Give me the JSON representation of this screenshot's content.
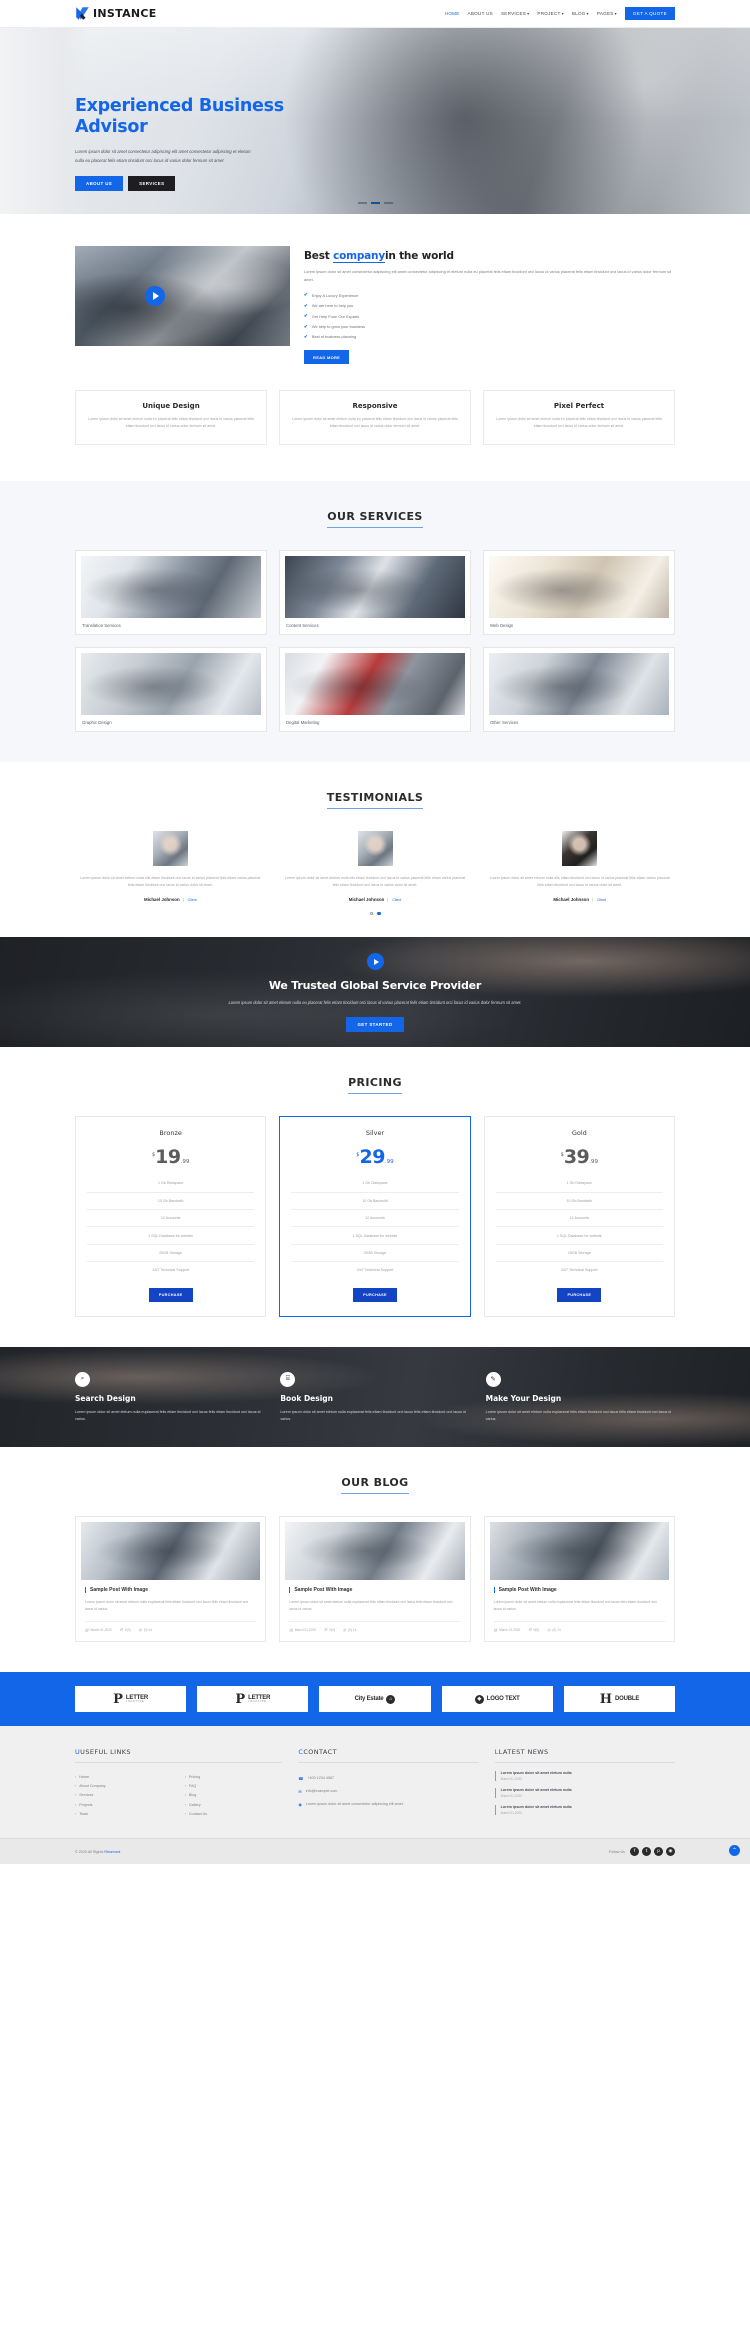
{
  "header": {
    "brand": "INSTANCE",
    "logo_icon": "x-logo-icon",
    "nav": [
      {
        "label": "HOME",
        "active": true,
        "caret": false
      },
      {
        "label": "ABOUT US",
        "active": false,
        "caret": false
      },
      {
        "label": "SERVICES",
        "active": false,
        "caret": true
      },
      {
        "label": "PROJECT",
        "active": false,
        "caret": true
      },
      {
        "label": "BLOG",
        "active": false,
        "caret": true
      },
      {
        "label": "PAGES",
        "active": false,
        "caret": true
      }
    ],
    "cta": "GET A QUOTE",
    "accent": "#1366e8"
  },
  "hero": {
    "title": "Experienced Business Advisor",
    "paragraph": "Lorem ipsum dolor sit amet consectetur adipiscing elit amet consectetur adipiscing et eletum nulla eu placerat felis etiam tincidunt orci lacus id varius dolor fermum sit amet",
    "btn_primary": "ABOUT US",
    "btn_secondary": "SERVICES",
    "dots": [
      false,
      true,
      false
    ]
  },
  "about": {
    "heading_pre": "Best ",
    "heading_hl": "company",
    "heading_post": "in the world",
    "paragraph": "Lorem ipsum dolor sit amet consectetur adipiscing elit amet consectetur adipiscing et eletum nulla eu placerat felis etiam tincidunt orci lacus id varius placerat felis etiam tincidunt orci lacus id varius dolor fermum sit amet.",
    "checks": [
      "Enjoy A Luxury Experience",
      "We are here to help you",
      "Get Help From Our Exparts",
      "We help to grow your business",
      "Best of business planning"
    ],
    "button": "READ MORE",
    "play_icon": "play-icon"
  },
  "features": [
    {
      "title": "Unique Design",
      "text": "Lorem ipsum dolor sit amet eletum nulla eu placerat felis etiam tincidunt orci lacus id varius placerat felis etiam tincidunt orci lacus id varius dolor fermum sit amet."
    },
    {
      "title": "Responsive",
      "text": "Lorem ipsum dolor sit amet eletum nulla eu placerat felis etiam tincidunt orci lacus id varius placerat felis etiam tincidunt orci lacus id varius dolor fermum sit amet."
    },
    {
      "title": "Pixel Perfect",
      "text": "Lorem ipsum dolor sit amet eletum nulla eu placerat felis etiam tincidunt orci lacus id varius placerat felis etiam tincidunt orci lacus id varius dolor fermum sit amet."
    }
  ],
  "services": {
    "title": "OUR SERVICES",
    "items": [
      {
        "caption": "Translation Services"
      },
      {
        "caption": "Content Services"
      },
      {
        "caption": "Web Design"
      },
      {
        "caption": "Graphic Design"
      },
      {
        "caption": "Degital Marketing"
      },
      {
        "caption": "Other Services"
      }
    ]
  },
  "testimonials": {
    "title": "TESTIMONIALS",
    "items": [
      {
        "quote": "Lorem ipsum dolor sit amet eletum nulla elis etiam tincidunt orci lacus id varius placerat felis etiam varius placerat felis etiam tincidunt orci lacus id varius dolor sit amet.",
        "name": "Michael Johnson",
        "role": "Client"
      },
      {
        "quote": "Lorem ipsum dolor sit amet eletum nulla elis etiam tincidunt orci lacus id varius placerat felis etiam varius placerat felis etiam tincidunt orci lacus id varius dolor sit amet.",
        "name": "Michael Johnson",
        "role": "Client"
      },
      {
        "quote": "Lorem ipsum dolor sit amet eletum nulla elis etiam tincidunt orci lacus id varius placerat felis etiam varius placerat felis etiam tincidunt orci lacus id varius dolor sit amet.",
        "name": "Michael Johnson",
        "role": "Client"
      }
    ],
    "dots": [
      false,
      true
    ]
  },
  "cta": {
    "title": "We Trusted Global Service Provider",
    "paragraph": "Lorem ipsum dolor sit amet eletum nulla eu placerat felis etiam tincidunt orci lacus id varius placerat felis etiam tincidunt orci lacus id varius dolor fermum sit amet.",
    "button": "GET STARTED",
    "play_icon": "play-icon"
  },
  "pricing": {
    "title": "PRICING",
    "plans": [
      {
        "name": "Bronze",
        "currency": "$",
        "price": "19",
        "cents": ".99",
        "featured": false,
        "features": [
          "1 Gb Diskspace",
          "10 Gb Bandwith",
          "12 Accounts",
          "1 SQL Database for website",
          "25GB Storage",
          "24/7 Technical Support"
        ],
        "button": "PURCHASE"
      },
      {
        "name": "Silver",
        "currency": "$",
        "price": "29",
        "cents": ".99",
        "featured": true,
        "features": [
          "1 Gb Diskspace",
          "10 Gb Bandwith",
          "12 Accounts",
          "1 SQL Database for website",
          "25GB Storage",
          "24/7 Technical Support"
        ],
        "button": "PURCHASE"
      },
      {
        "name": "Gold",
        "currency": "$",
        "price": "39",
        "cents": ".99",
        "featured": false,
        "features": [
          "1 Gb Diskspace",
          "10 Gb Bandwith",
          "12 Accounts",
          "1 SQL Database for website",
          "25GB Storage",
          "24/7 Technical Support"
        ],
        "button": "PURCHASE"
      }
    ]
  },
  "process": [
    {
      "icon": "search-icon",
      "glyph": "⌕",
      "title": "Search Design",
      "text": "Lorem ipsum dolor sit amet eletum nulla euplacerat felis etiam tincidunt orci lacus felis etiam tincidunt orci lacus id varius."
    },
    {
      "icon": "book-icon",
      "glyph": "⌸",
      "title": "Book Design",
      "text": "Lorem ipsum dolor sit amet eletum nulla euplacerat felis etiam tincidunt orci lacus felis etiam tincidunt orci lacus id varius."
    },
    {
      "icon": "pencil-icon",
      "glyph": "✎",
      "title": "Make Your Design",
      "text": "Lorem ipsum dolor sit amet eletum nulla euplacerat felis etiam tincidunt orci lacus felis etiam tincidunt orci lacus id varius."
    }
  ],
  "blog": {
    "title": "OUR BLOG",
    "posts": [
      {
        "title": "Sample Post With Image",
        "text": "Lorem ipsum dolor sit amet eletum nulla euplacerat felis etiam tincidunt orci lacus felis etiam tincidunt orci lacus id varius.",
        "date": "March 01,2020",
        "comments": "0(0)",
        "likes": "(0) 14"
      },
      {
        "title": "Sample Post With Image",
        "text": "Lorem ipsum dolor sit amet eletum nulla euplacerat felis etiam tincidunt orci lacus felis etiam tincidunt orci lacus id varius.",
        "date": "March 01,2020",
        "comments": "0(0)",
        "likes": "(0) 14"
      },
      {
        "title": "Sample Post With Image",
        "text": "Lorem ipsum dolor sit amet eletum nulla euplacerat felis etiam tincidunt orci lacus felis etiam tincidunt orci lacus id varius.",
        "date": "March 01,2020",
        "comments": "0(0)",
        "likes": "(0) 14"
      }
    ]
  },
  "clients": [
    {
      "type": "letter",
      "letter": "P",
      "main": "LETTER",
      "sub": "LOGOTYPE"
    },
    {
      "type": "letter",
      "letter": "P",
      "main": "LETTER",
      "sub": "LOGOTYPE"
    },
    {
      "type": "circle",
      "main": "City Estate",
      "badge": "⌂"
    },
    {
      "type": "circle",
      "main": "LOGO TEXT",
      "badge": "◆"
    },
    {
      "type": "letter",
      "letter": "H",
      "main": "DOUBLE",
      "sub": ""
    }
  ],
  "footer": {
    "useful_links": {
      "title": "USEFUL LINKS",
      "col1": [
        "Home",
        "About Company",
        "Services",
        "Projects",
        "Team"
      ],
      "col2": [
        "Pricing",
        "FAQ",
        "Blog",
        "Gallery",
        "Contact Us"
      ]
    },
    "contact": {
      "title": "CONTACT",
      "items": [
        {
          "icon": "phone-icon",
          "glyph": "☎",
          "text": "+100 1234 4567"
        },
        {
          "icon": "mail-icon",
          "glyph": "✉",
          "text": "info@example.com"
        },
        {
          "icon": "pin-icon",
          "glyph": "◉",
          "text": "Lorem ipsum dolor sit amet consectetur adipiscing elit amet."
        }
      ]
    },
    "latest_news": {
      "title": "LATEST NEWS",
      "items": [
        {
          "title": "Lorem ipsum dolor sit amet eletum nulla",
          "date": "March 01,2020"
        },
        {
          "title": "Lorem ipsum dolor sit amet eletum nulla",
          "date": "March 01,2020"
        },
        {
          "title": "Lorem ipsum dolor sit amet eletum nulla",
          "date": "March 01,2020"
        }
      ]
    },
    "copyright_pre": "© 2020 All Rights ",
    "copyright_hl": "Reserved.",
    "follow_label": "Follow Us",
    "social": [
      {
        "name": "facebook-icon",
        "glyph": "f"
      },
      {
        "name": "twitter-icon",
        "glyph": "t"
      },
      {
        "name": "pinterest-icon",
        "glyph": "p"
      },
      {
        "name": "instagram-icon",
        "glyph": "◉"
      }
    ],
    "to_top_icon": "chevron-up-icon"
  }
}
